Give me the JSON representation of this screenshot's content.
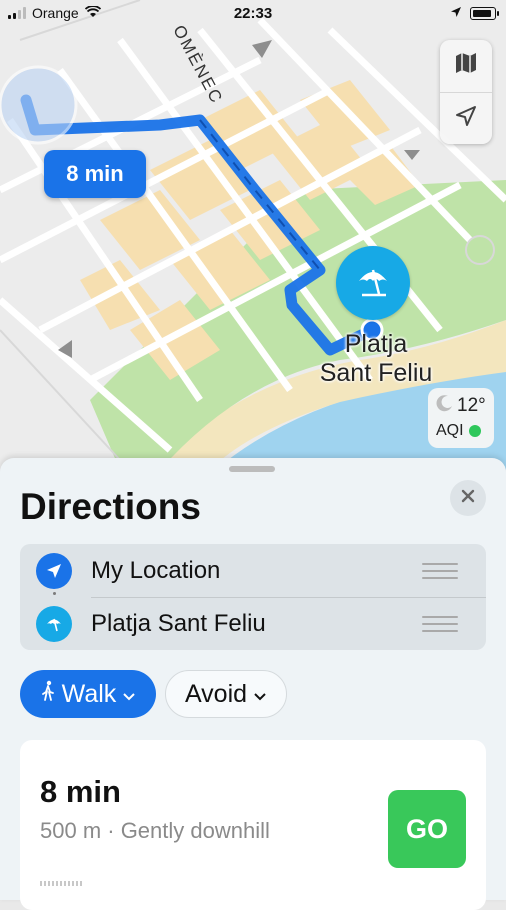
{
  "status_bar": {
    "carrier": "Orange",
    "time": "22:33"
  },
  "map": {
    "street_label": "OMÈNEC",
    "eta_label": "8 min",
    "destination_label_line1": "Platja",
    "destination_label_line2": "Sant Feliu",
    "weather": {
      "temperature": "12°",
      "aqi_label": "AQI",
      "aqi_color": "#2ec75b"
    },
    "route_color": "#1a73e8",
    "controls": {
      "map_mode_icon": "map-icon",
      "locate_icon": "location-arrow-icon"
    }
  },
  "sheet": {
    "title": "Directions",
    "waypoints": [
      {
        "label": "My Location",
        "icon": "location-arrow-icon"
      },
      {
        "label": "Platja Sant Feliu",
        "icon": "beach-umbrella-icon"
      }
    ],
    "modes": {
      "walk_label": "Walk",
      "avoid_label": "Avoid"
    },
    "route": {
      "time": "8 min",
      "detail": "500 m · Gently downhill",
      "go_label": "GO"
    },
    "accent_color": "#1a73e8",
    "go_color": "#39c85a"
  }
}
